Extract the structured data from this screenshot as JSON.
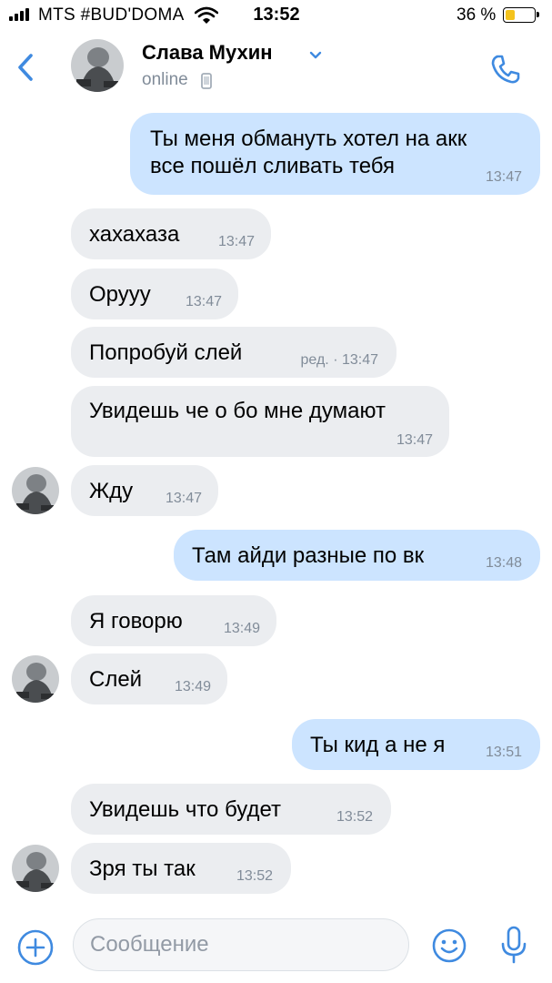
{
  "status_bar": {
    "carrier": "MTS #BUD'DOMA",
    "time": "13:52",
    "battery": "36 %",
    "battery_level": 0.36,
    "icons": [
      "signal-icon",
      "wifi-icon",
      "battery-icon"
    ]
  },
  "header": {
    "name": "Слава Мухин",
    "status": "online",
    "icons": [
      "back-icon",
      "chevron-down-icon",
      "mobile-icon",
      "phone-icon"
    ]
  },
  "colors": {
    "accent": "#3f8ae0",
    "incoming_bubble": "#ebedf0",
    "outgoing_bubble": "#cce4ff",
    "meta_text": "#818c99"
  },
  "messages": [
    {
      "dir": "out",
      "text": "Ты меня обмануть хотел на акк все пошёл сливать тебя",
      "time": "13:47"
    },
    {
      "dir": "in",
      "text": "хахахаза",
      "time": "13:47"
    },
    {
      "dir": "in",
      "text": "Оруyy",
      "time": "13:47"
    },
    {
      "dir": "in",
      "text": "Попробуй слей",
      "time": "ред. · 13:47"
    },
    {
      "dir": "in",
      "text": "Увидешь че о бо мне думают",
      "time": "13:47"
    },
    {
      "dir": "in",
      "text": "Жду",
      "time": "13:47"
    },
    {
      "dir": "out",
      "text": "Там айди разные по вк",
      "time": "13:48"
    },
    {
      "dir": "in",
      "text": "Я говорю",
      "time": "13:49"
    },
    {
      "dir": "in",
      "text": "Слей",
      "time": "13:49"
    },
    {
      "dir": "out",
      "text": "Ты кид а не я",
      "time": "13:51"
    },
    {
      "dir": "in",
      "text": "Увидешь что будет",
      "time": "13:52"
    },
    {
      "dir": "in",
      "text": "Зря ты так",
      "time": "13:52"
    }
  ],
  "composer": {
    "placeholder": "Сообщение",
    "icons": [
      "add-icon",
      "smile-icon",
      "microphone-icon"
    ]
  }
}
